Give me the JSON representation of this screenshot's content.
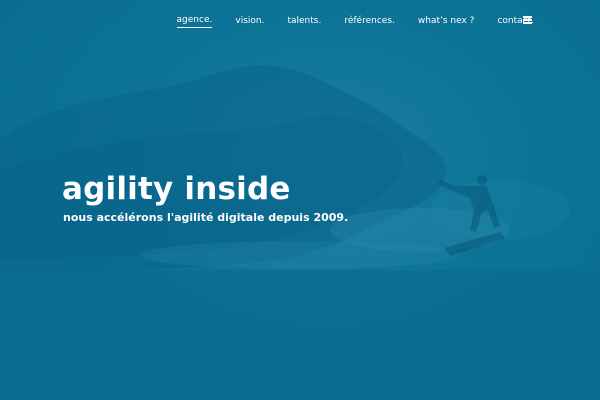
{
  "nav": {
    "items": [
      {
        "label": "agence.",
        "active": true
      },
      {
        "label": "vision.",
        "active": false
      },
      {
        "label": "talents.",
        "active": false
      },
      {
        "label": "références.",
        "active": false
      },
      {
        "label": "what’s nex ?",
        "active": false
      },
      {
        "label": "contact.",
        "active": false
      }
    ],
    "menu_icon": "hamburger-menu-icon"
  },
  "hero": {
    "title": "agility inside",
    "subtitle": "nous accélérons l'agilité digitale depuis 2009.",
    "background_image": "surfer-riding-wave-blue-tint"
  },
  "colors": {
    "background": "#0b6f92",
    "text": "#ffffff"
  }
}
